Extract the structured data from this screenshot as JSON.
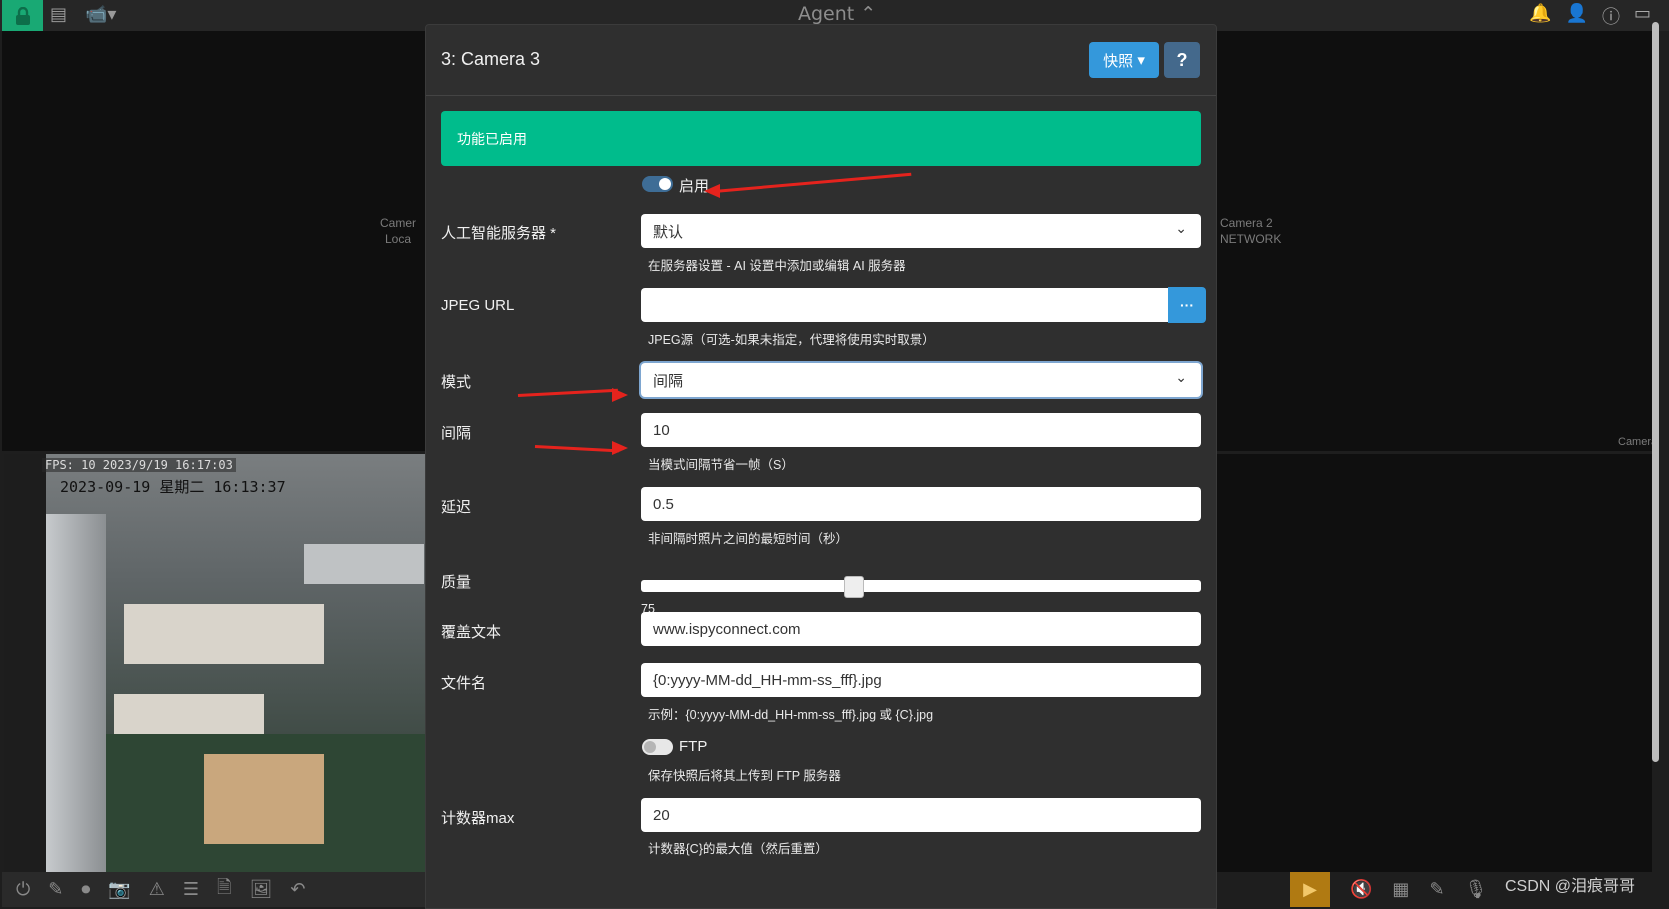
{
  "topbar": {
    "title": "Agent",
    "left_icons": [
      "lock-icon",
      "server-icon",
      "cctv-icon"
    ],
    "right_icons": [
      "bell-icon",
      "user-icon",
      "info-icon",
      "window-icon"
    ]
  },
  "background": {
    "camera_left_label": "Camer",
    "camera_left_sub": "Loca",
    "camera_right_label": "Camera 2",
    "camera_right_sub": "NETWORK",
    "camera_bottom_right": "Camera",
    "feed_fps": "FPS: 10 2023/9/19 16:17:03",
    "feed_timestamp": "2023-09-19 星期二 16:13:37"
  },
  "modal": {
    "title": "3: Camera 3",
    "snapshot_button": "快照",
    "help_button": "?",
    "alert": "功能已启用",
    "enable": {
      "label": "启用",
      "on": true
    },
    "ai_server": {
      "label": "人工智能服务器 *",
      "value": "默认",
      "help": "在服务器设置 - AI 设置中添加或编辑 AI 服务器"
    },
    "jpeg_url": {
      "label": "JPEG URL",
      "value": "",
      "button": "···",
      "help": "JPEG源（可选-如果未指定，代理将使用实时取景）"
    },
    "mode": {
      "label": "模式",
      "value": "间隔"
    },
    "interval": {
      "label": "间隔",
      "value": "10",
      "help": "当模式间隔节省一帧（S）"
    },
    "delay": {
      "label": "延迟",
      "value": "0.5",
      "help": "非间隔时照片之间的最短时间（秒）"
    },
    "quality": {
      "label": "质量",
      "value": 75,
      "min": 0,
      "max": 200
    },
    "overlay_text": {
      "label": "覆盖文本",
      "value": "www.ispyconnect.com"
    },
    "filename": {
      "label": "文件名",
      "value": "{0:yyyy-MM-dd_HH-mm-ss_fff}.jpg",
      "help": "示例：{0:yyyy-MM-dd_HH-mm-ss_fff}.jpg 或 {C}.jpg"
    },
    "ftp": {
      "label": "FTP",
      "on": false,
      "help": "保存快照后将其上传到 FTP 服务器"
    },
    "counter_max": {
      "label": "计数器max",
      "value": "20",
      "help": "计数器{C}的最大值（然后重置）"
    }
  },
  "bottom_toolbar_left": [
    "power-icon",
    "edit-icon",
    "record-icon",
    "camera-icon",
    "alert-icon",
    "checklist-icon",
    "file-icon",
    "image-icon",
    "undo-icon"
  ],
  "bottom_toolbar_right": [
    "play-icon",
    "mute-icon",
    "grid-icon",
    "edit-icon",
    "mic-icon"
  ],
  "watermark": "CSDN @泪痕哥哥",
  "colors": {
    "accent": "#3498db",
    "success": "#00bc8c",
    "annotation_arrow": "#e5231d",
    "lock": "#19a974"
  }
}
